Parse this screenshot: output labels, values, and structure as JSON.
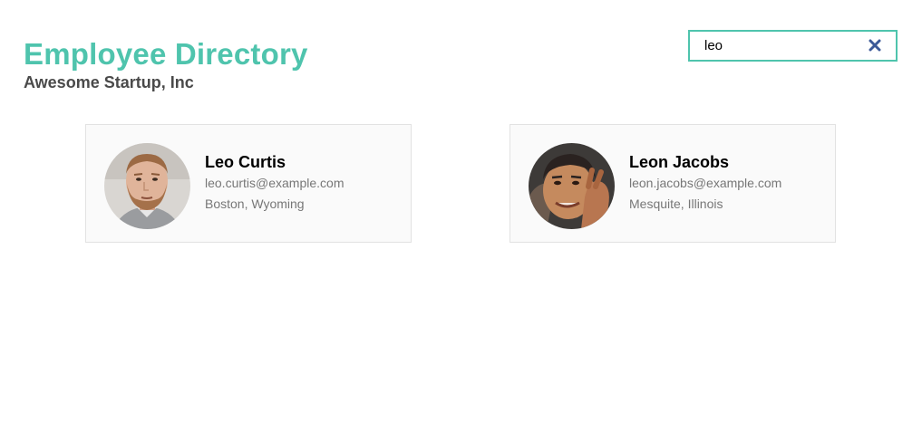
{
  "header": {
    "title": "Employee Directory",
    "subtitle": "Awesome Startup, Inc"
  },
  "search": {
    "value": "leo",
    "clear_icon": "close-icon"
  },
  "colors": {
    "accent": "#4fc4ad",
    "clear_icon": "#3b5998",
    "subtitle": "#4a4a4a",
    "card_bg": "#fafafa",
    "secondary_text": "#777777"
  },
  "employees": [
    {
      "name": "Leo Curtis",
      "email": "leo.curtis@example.com",
      "location": "Boston, Wyoming"
    },
    {
      "name": "Leon Jacobs",
      "email": "leon.jacobs@example.com",
      "location": "Mesquite, Illinois"
    }
  ]
}
